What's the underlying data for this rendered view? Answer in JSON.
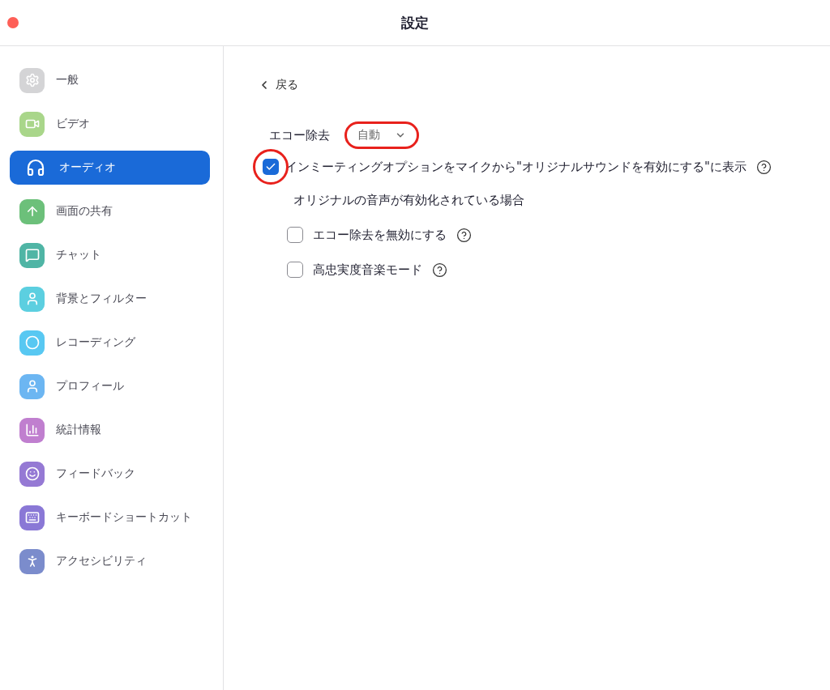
{
  "window": {
    "title": "設定"
  },
  "sidebar": {
    "items": [
      {
        "label": "一般",
        "selected": false,
        "color": "#d4d4d6"
      },
      {
        "label": "ビデオ",
        "selected": false,
        "color": "#a9d68a"
      },
      {
        "label": "オーディオ",
        "selected": true,
        "color": "#1a6ad8"
      },
      {
        "label": "画面の共有",
        "selected": false,
        "color": "#6cc07a"
      },
      {
        "label": "チャット",
        "selected": false,
        "color": "#4fb5a5"
      },
      {
        "label": "背景とフィルター",
        "selected": false,
        "color": "#5ccfe0"
      },
      {
        "label": "レコーディング",
        "selected": false,
        "color": "#58c8f2"
      },
      {
        "label": "プロフィール",
        "selected": false,
        "color": "#6cb6f2"
      },
      {
        "label": "統計情報",
        "selected": false,
        "color": "#c07fcf"
      },
      {
        "label": "フィードバック",
        "selected": false,
        "color": "#9579d4"
      },
      {
        "label": "キーボードショートカット",
        "selected": false,
        "color": "#8a78d6"
      },
      {
        "label": "アクセシビリティ",
        "selected": false,
        "color": "#7b8ccc"
      }
    ]
  },
  "back": {
    "label": "戻る"
  },
  "echo": {
    "label": "エコー除去",
    "value": "自動",
    "annotated": true
  },
  "original_sound": {
    "label": "インミーティングオプションをマイクから\"オリジナルサウンドを有効にする\"に表示",
    "checked": true,
    "annotated": true
  },
  "subheading": "オリジナルの音声が有効化されている場合",
  "options": [
    {
      "label": "エコー除去を無効にする",
      "checked": false
    },
    {
      "label": "高忠実度音楽モード",
      "checked": false
    }
  ]
}
